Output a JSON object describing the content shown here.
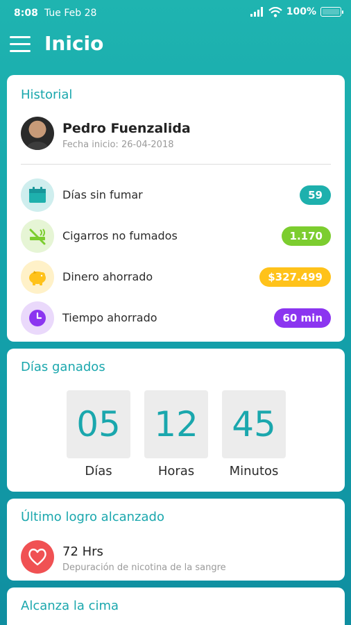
{
  "status_bar": {
    "time": "8:08",
    "date": "Tue Feb 28",
    "battery": "100%"
  },
  "app_bar": {
    "title": "Inicio"
  },
  "historial": {
    "title": "Historial",
    "user": {
      "name": "Pedro Fuenzalida",
      "start_date": "Fecha inicio: 26-04-2018"
    },
    "stats": [
      {
        "label": "Días sin fumar",
        "value": "59",
        "color": "#1eb0ad",
        "icon_bg": "#cfeeee",
        "icon": "calendar-icon"
      },
      {
        "label": "Cigarros no fumados",
        "value": "1.170",
        "color": "#7ccd2f",
        "icon_bg": "#e6f5d5",
        "icon": "no-smoking-icon"
      },
      {
        "label": "Dinero ahorrado",
        "value": "$327.499",
        "color": "#ffc21a",
        "icon_bg": "#fff1c8",
        "icon": "piggy-bank-icon"
      },
      {
        "label": "Tiempo ahorrado",
        "value": "60 min",
        "color": "#8b35f0",
        "icon_bg": "#ead9fb",
        "icon": "clock-icon"
      }
    ]
  },
  "dias_ganados": {
    "title": "Días ganados",
    "counters": [
      {
        "value": "05",
        "label": "Días"
      },
      {
        "value": "12",
        "label": "Horas"
      },
      {
        "value": "45",
        "label": "Minutos"
      }
    ]
  },
  "ultimo_logro": {
    "title": "Último logro alcanzado",
    "achievement": {
      "title": "72 Hrs",
      "description": "Depuración de nicotina de la sangre"
    }
  },
  "alcanza_cima": {
    "title": "Alcanza la cima"
  }
}
